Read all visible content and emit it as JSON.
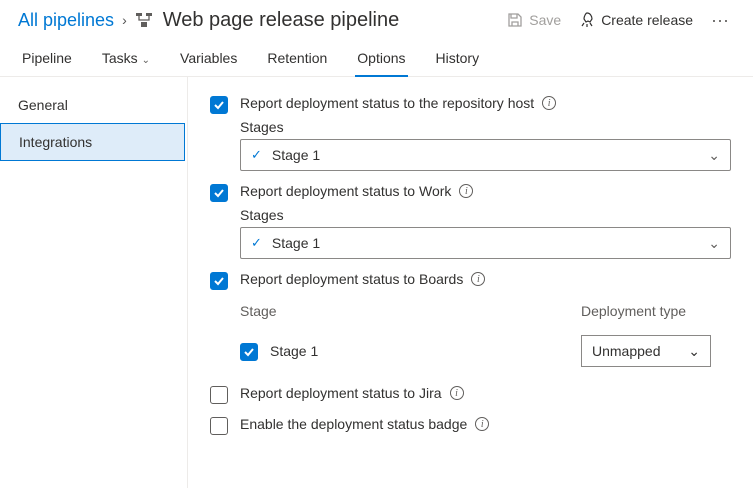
{
  "breadcrumb": {
    "root": "All pipelines",
    "current": "Web page release pipeline"
  },
  "toolbar": {
    "save": "Save",
    "create": "Create release"
  },
  "tabs": {
    "pipeline": "Pipeline",
    "tasks": "Tasks",
    "variables": "Variables",
    "retention": "Retention",
    "options": "Options",
    "history": "History"
  },
  "side": {
    "general": "General",
    "integrations": "Integrations"
  },
  "opts": {
    "repoHost": {
      "label": "Report deployment status to the repository host",
      "stagesLabel": "Stages",
      "stage": "Stage 1"
    },
    "work": {
      "label": "Report deployment status to Work",
      "stagesLabel": "Stages",
      "stage": "Stage 1"
    },
    "boards": {
      "label": "Report deployment status to Boards",
      "colStage": "Stage",
      "colType": "Deployment type",
      "stage": "Stage 1",
      "type": "Unmapped"
    },
    "jira": {
      "label": "Report deployment status to Jira"
    },
    "badge": {
      "label": "Enable the deployment status badge"
    }
  }
}
